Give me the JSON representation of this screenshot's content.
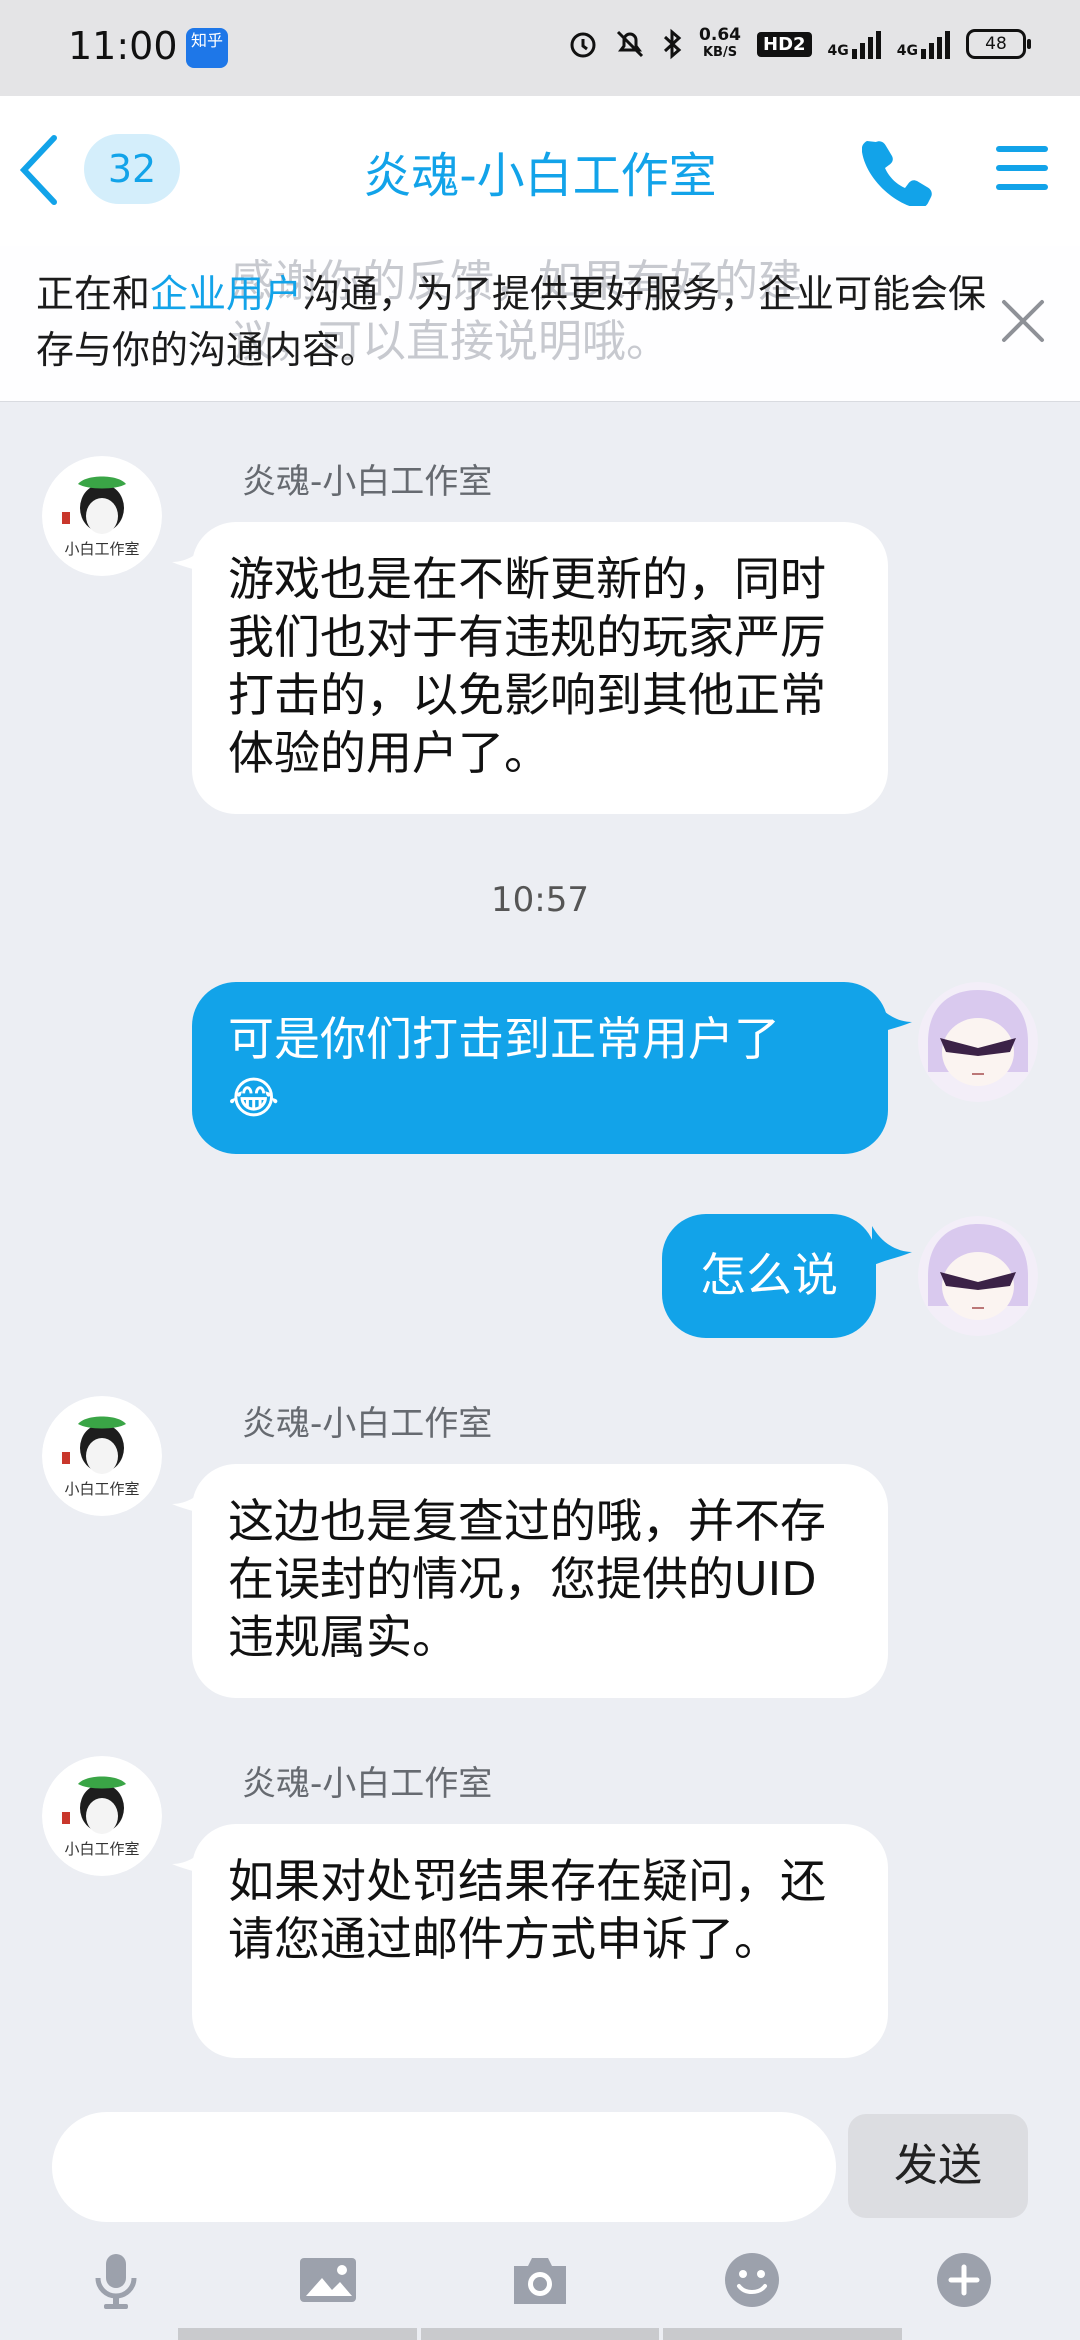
{
  "status_bar": {
    "time": "11:00",
    "app_icon_label": "知乎",
    "net_speed_value": "0.64",
    "net_speed_unit": "KB/S",
    "hd_label": "HD2",
    "signal_1": "4G",
    "signal_2": "4G",
    "battery": "48"
  },
  "header": {
    "unread_count": "32",
    "title": "炎魂-小白工作室"
  },
  "notice": {
    "ghost_text": "感谢你的反馈，如果有好的建议，可以直接说明哦。",
    "prefix": "正在和",
    "highlight": "企业用户",
    "suffix": "沟通，为了提供更好服务，企业可能会保存与你的沟通内容。"
  },
  "messages": [
    {
      "side": "in",
      "sender": "炎魂-小白工作室",
      "avatar_text": "小白工作室",
      "text": "游戏也是在不断更新的，同时我们也对于有违规的玩家严厉打击的，以免影响到其他正常体验的用户了。"
    },
    {
      "side": "time",
      "text": "10:57"
    },
    {
      "side": "out",
      "text": "可是你们打击到正常用户了",
      "emoji": "😂"
    },
    {
      "side": "out",
      "text": "怎么说"
    },
    {
      "side": "in",
      "sender": "炎魂-小白工作室",
      "avatar_text": "小白工作室",
      "text": "这边也是复查过的哦，并不存在误封的情况，您提供的UID违规属实。"
    },
    {
      "side": "in",
      "sender": "炎魂-小白工作室",
      "avatar_text": "小白工作室",
      "text": "如果对处罚结果存在疑问，还请您通过邮件方式申诉了。"
    }
  ],
  "composer": {
    "input_value": "",
    "send_label": "发送"
  },
  "toolbar": [
    "microphone-icon",
    "image-icon",
    "camera-icon",
    "emoji-icon",
    "plus-icon"
  ],
  "colors": {
    "accent": "#12a3e9",
    "background": "#eceef3",
    "bubble_in": "#ffffff",
    "bubble_out": "#12a3e9",
    "tool_icon": "#9ca1ac"
  }
}
